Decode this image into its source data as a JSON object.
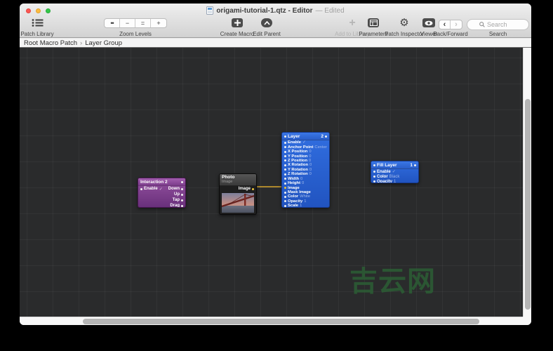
{
  "window": {
    "title": "origami-tutorial-1.qtz - Editor",
    "title_suffix": "— Edited"
  },
  "toolbar": {
    "patch_library_label": "Patch Library",
    "zoom_levels": {
      "label": "Zoom Levels",
      "buttons": [
        "••",
        "−",
        "=",
        "+"
      ]
    },
    "create_macro_label": "Create Macro",
    "edit_parent_label": "Edit Parent",
    "add_to_library_label": "Add to Library",
    "parameters_label": "Parameters",
    "patch_inspector_label": "Patch Inspector",
    "viewer_label": "Viewer",
    "back_forward_label": "Back/Forward",
    "back_glyph": "‹",
    "forward_glyph": "›",
    "search": {
      "label": "Search",
      "placeholder": "Search"
    }
  },
  "breadcrumb": {
    "items": [
      "Root Macro Patch",
      "Layer Group"
    ],
    "separator": "›"
  },
  "nodes": {
    "interaction": {
      "title": "Interaction 2",
      "left_ports": [
        {
          "name": "Enable",
          "value": "✓"
        }
      ],
      "right_ports": [
        {
          "name": "Down"
        },
        {
          "name": "Up"
        },
        {
          "name": "Tap"
        },
        {
          "name": "Drag"
        }
      ]
    },
    "photo": {
      "title": "Photo",
      "subtitle": "Image",
      "right_ports": [
        {
          "name": "Image",
          "dot": "yellow"
        }
      ]
    },
    "layer": {
      "title": "Layer",
      "badge": "2",
      "left_ports": [
        {
          "name": "Enable",
          "value": "✓"
        },
        {
          "name": "Anchor Point",
          "value": "Center"
        },
        {
          "name": "X Position",
          "value": "0"
        },
        {
          "name": "Y Position",
          "value": "0"
        },
        {
          "name": "Z Position",
          "value": "0"
        },
        {
          "name": "X Rotation",
          "value": "0"
        },
        {
          "name": "Y Rotation",
          "value": "0"
        },
        {
          "name": "Z Rotation",
          "value": "0"
        },
        {
          "name": "Width",
          "value": "0"
        },
        {
          "name": "Height",
          "value": "0"
        },
        {
          "name": "Image",
          "dot": "yellow"
        },
        {
          "name": "Mask Image"
        },
        {
          "name": "Color",
          "value": "White"
        },
        {
          "name": "Opacity",
          "value": "1"
        },
        {
          "name": "Scale",
          "value": "1"
        }
      ]
    },
    "fill_layer": {
      "title": "Fill Layer",
      "badge": "1",
      "left_ports": [
        {
          "name": "Enable",
          "value": "✓"
        },
        {
          "name": "Color",
          "value": "Black"
        },
        {
          "name": "Opacity",
          "value": "1"
        }
      ]
    }
  },
  "watermark": {
    "text": "吉云网"
  },
  "colors": {
    "canvas_bg": "#2a2b2c",
    "node_blue": "#2a62d4",
    "node_purple": "#7c3d8c",
    "wire_yellow": "#d8a62c",
    "port_yellow": "#ecc43a",
    "watermark_green": "#2c5a34"
  }
}
